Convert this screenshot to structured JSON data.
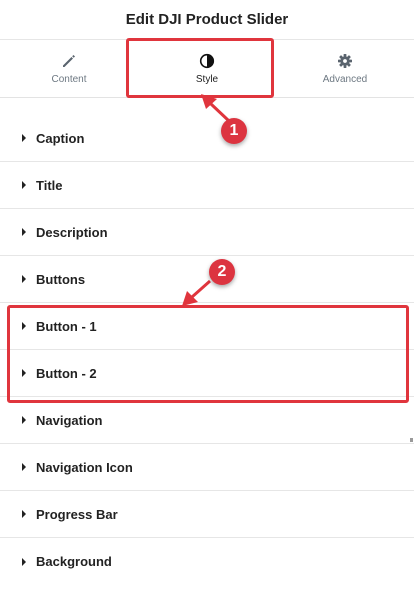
{
  "header": {
    "title": "Edit DJI Product Slider"
  },
  "tabs": [
    {
      "label": "Content",
      "icon": "pencil-icon"
    },
    {
      "label": "Style",
      "icon": "half-circle-contrast-icon"
    },
    {
      "label": "Advanced",
      "icon": "gear-icon"
    }
  ],
  "sections": [
    {
      "label": "Caption"
    },
    {
      "label": "Title"
    },
    {
      "label": "Description"
    },
    {
      "label": "Buttons"
    },
    {
      "label": "Button - 1"
    },
    {
      "label": "Button - 2"
    },
    {
      "label": "Navigation"
    },
    {
      "label": "Navigation Icon"
    },
    {
      "label": "Progress Bar"
    },
    {
      "label": "Background"
    }
  ],
  "annotations": [
    {
      "number": "1"
    },
    {
      "number": "2"
    }
  ],
  "colors": {
    "highlight": "#e0353d",
    "badge": "#dc3440",
    "text": "#222222",
    "tab_muted": "#6d7882"
  }
}
